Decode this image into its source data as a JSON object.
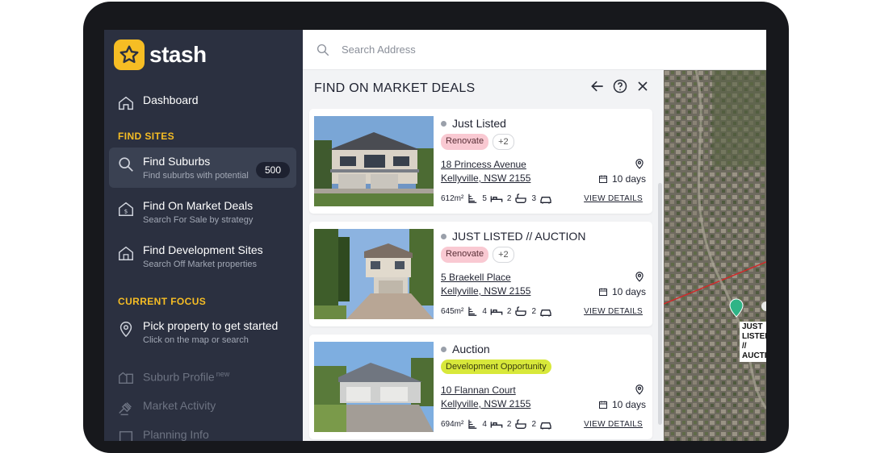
{
  "app": {
    "name": "stash"
  },
  "sidebar": {
    "dashboard": "Dashboard",
    "find_sites_label": "FIND SITES",
    "find_suburbs": {
      "title": "Find Suburbs",
      "subtitle": "Find suburbs with potential",
      "count": "500"
    },
    "find_on_market": {
      "title": "Find On Market Deals",
      "subtitle": "Search For Sale by strategy"
    },
    "find_development": {
      "title": "Find Development Sites",
      "subtitle": "Search Off Market properties"
    },
    "current_focus_label": "CURRENT FOCUS",
    "pick_property": {
      "title": "Pick property to get started",
      "subtitle": "Click on the map or search"
    },
    "suburb_profile": {
      "title": "Suburb Profile",
      "tag": "new"
    },
    "market_activity": "Market Activity",
    "planning_info": "Planning Info"
  },
  "search": {
    "placeholder": "Search Address"
  },
  "panel": {
    "title": "FIND ON MARKET DEALS",
    "listings": [
      {
        "status": "Just Listed",
        "tags": [
          "Renovate",
          "+2"
        ],
        "address1": "18 Princess Avenue",
        "address2": "Kellyville, NSW 2155",
        "days": "10 days",
        "land": "612m²",
        "beds": "5",
        "baths": "2",
        "living": "3",
        "cars": "",
        "view": "VIEW DETAILS"
      },
      {
        "status": "JUST LISTED // AUCTION",
        "tags": [
          "Renovate",
          "+2"
        ],
        "address1": "5 Braekell Place",
        "address2": "Kellyville, NSW 2155",
        "days": "10 days",
        "land": "645m²",
        "beds": "4",
        "baths": "2",
        "living": "2",
        "cars": "",
        "view": "VIEW DETAILS"
      },
      {
        "status": "Auction",
        "tags": [
          "Development Opportunity"
        ],
        "address1": "10 Flannan Court",
        "address2": "Kellyville, NSW 2155",
        "days": "10 days",
        "land": "694m²",
        "beds": "4",
        "baths": "2",
        "living": "2",
        "cars": "",
        "view": "VIEW DETAILS"
      }
    ]
  },
  "map": {
    "label": "JUST LISTED // AUCTION"
  },
  "colors": {
    "accent": "#f6bd24",
    "sidebar": "#2b3040",
    "marker": "#2fb486"
  }
}
